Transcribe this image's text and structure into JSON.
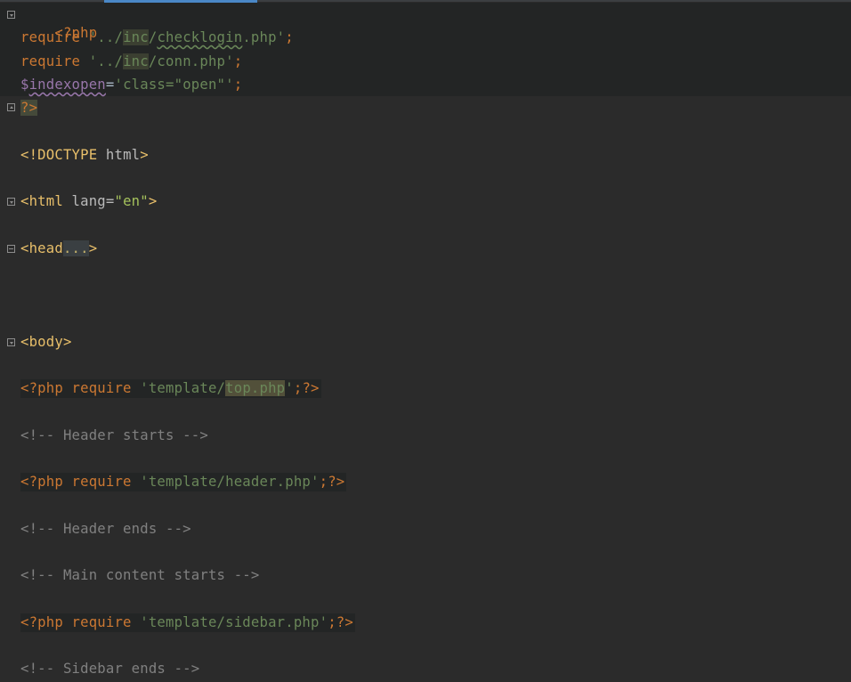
{
  "window": {
    "accent": "#4a88c7",
    "background": "#2b2b2b"
  },
  "colors": {
    "keyword": "#cc7832",
    "string": "#6a8759",
    "tag": "#e8bf6a",
    "attribute": "#bababa",
    "attribute_value": "#a5c25c",
    "variable": "#9876aa",
    "comment": "#808080",
    "text": "#a9b7c6"
  },
  "code": {
    "l1": {
      "open": "<?php"
    },
    "l2": {
      "kw": "require",
      "s1": " '../",
      "s2": "inc",
      "s3": "/",
      "s4": "checklogin",
      "s5": ".php'",
      "end": ";"
    },
    "l3": {
      "kw": "require",
      "s1": " '../",
      "s2": "inc",
      "s3": "/conn.php'",
      "end": ";"
    },
    "l4": {
      "dollar": "$",
      "var": "indexopen",
      "eq": "=",
      "val": "'class=\"open\"'",
      "end": ";"
    },
    "l5": {
      "close": "?>"
    },
    "l6": {
      "t1": "<!DOCTYPE ",
      "t2": "html",
      "t3": ">"
    },
    "l7": {
      "t1": "<html ",
      "attr": "lang",
      "eq": "=",
      "val": "\"en\"",
      "t2": ">"
    },
    "l8": {
      "t1": "<head",
      "dots": "...",
      "t2": ">"
    },
    "l9": {
      "t1": "<body>"
    },
    "l10": {
      "open": "<?php ",
      "kw": "require",
      "s1": " 'template/",
      "s2": "top.php",
      "s3": "'",
      "end": ";",
      "close": "?>"
    },
    "l11": {
      "text": "<!-- Header starts -->"
    },
    "l12": {
      "open": "<?php ",
      "kw": "require",
      "s1": " 'template/header.php'",
      "end": ";",
      "close": "?>"
    },
    "l13": {
      "text": "<!-- Header ends -->"
    },
    "l14": {
      "text": "<!-- Main content starts -->"
    },
    "l15": {
      "open": "<?php ",
      "kw": "require",
      "s1": " 'template/sidebar.php'",
      "end": ";",
      "close": "?>"
    },
    "l16": {
      "text": "<!-- Sidebar ends -->"
    }
  }
}
